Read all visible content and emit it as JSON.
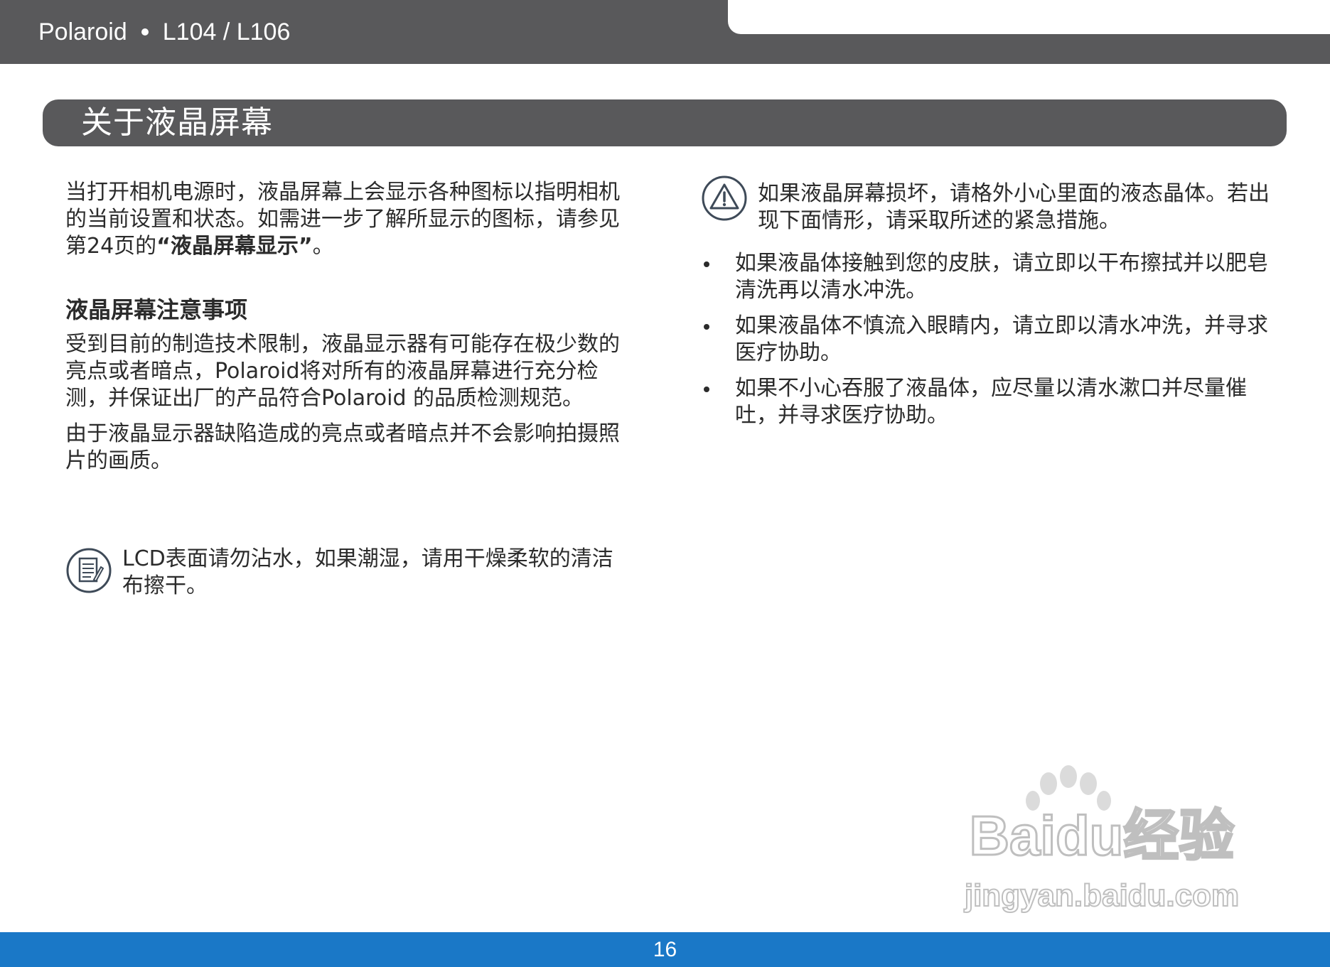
{
  "header": {
    "brand": "Polaroid",
    "model": "L104 / L106"
  },
  "section": {
    "title": "关于液晶屏幕"
  },
  "left": {
    "intro_before": "当打开相机电源时，液晶屏幕上会显示各种图标以指明相机的当前设置和状态。如需进一步了解所显示的图标，请参见第24页的",
    "intro_link": "“液晶屏幕显示”",
    "intro_after": "。",
    "heading": "液晶屏幕注意事项",
    "para1": "受到目前的制造技术限制，液晶显示器有可能存在极少数的亮点或者暗点，Polaroid将对所有的液晶屏幕进行充分检测，并保证出厂的产品符合Polaroid 的品质检测规范。",
    "para2": "由于液晶显示器缺陷造成的亮点或者暗点并不会影响拍摄照片的画质。",
    "note": "LCD表面请勿沾水，如果潮湿，请用干燥柔软的清洁布擦干。",
    "note_icon": "note-icon"
  },
  "right": {
    "warning": "如果液晶屏幕损坏，请格外小心里面的液态晶体。若出现下面情形，请采取所述的紧急措施。",
    "warning_icon": "warning-icon",
    "items": [
      "如果液晶体接触到您的皮肤，请立即以干布擦拭并以肥皂清洗再以清水冲洗。",
      "如果液晶体不慎流入眼睛内，请立即以清水冲洗，并寻求医疗协助。",
      "如果不小心吞服了液晶体，应尽量以清水漱口并尽量催吐，并寻求医疗协助。"
    ]
  },
  "watermark": {
    "logo": "Baidu经验",
    "url": "jingyan.baidu.com"
  },
  "footer": {
    "page_number": "16"
  },
  "colors": {
    "header_gray": "#59595b",
    "footer_blue": "#1a78c7"
  }
}
